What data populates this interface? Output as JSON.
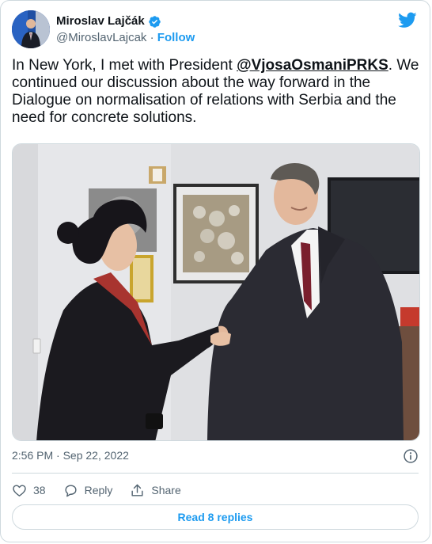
{
  "author": {
    "display_name": "Miroslav Lajčák",
    "handle": "@MiroslavLajcak",
    "separator": "·",
    "follow_label": "Follow"
  },
  "tweet": {
    "text_before": "In New York, I met with President ",
    "mention": "@VjosaOsmaniPRKS",
    "text_after": ". We continued our discussion about the way forward in the Dialogue on normalisation of relations with Serbia and the need for concrete solutions."
  },
  "meta": {
    "time": "2:56 PM",
    "separator": "·",
    "date": "Sep 22, 2022"
  },
  "actions": {
    "like_count": "38",
    "reply_label": "Reply",
    "share_label": "Share"
  },
  "read_replies_label": "Read 8 replies",
  "colors": {
    "accent": "#1d9bf0",
    "text": "#0f1419",
    "muted": "#536471",
    "border": "#cfd9de"
  },
  "icons": [
    "verified-badge-icon",
    "twitter-bird-icon",
    "info-icon",
    "heart-icon",
    "reply-icon",
    "share-icon"
  ]
}
